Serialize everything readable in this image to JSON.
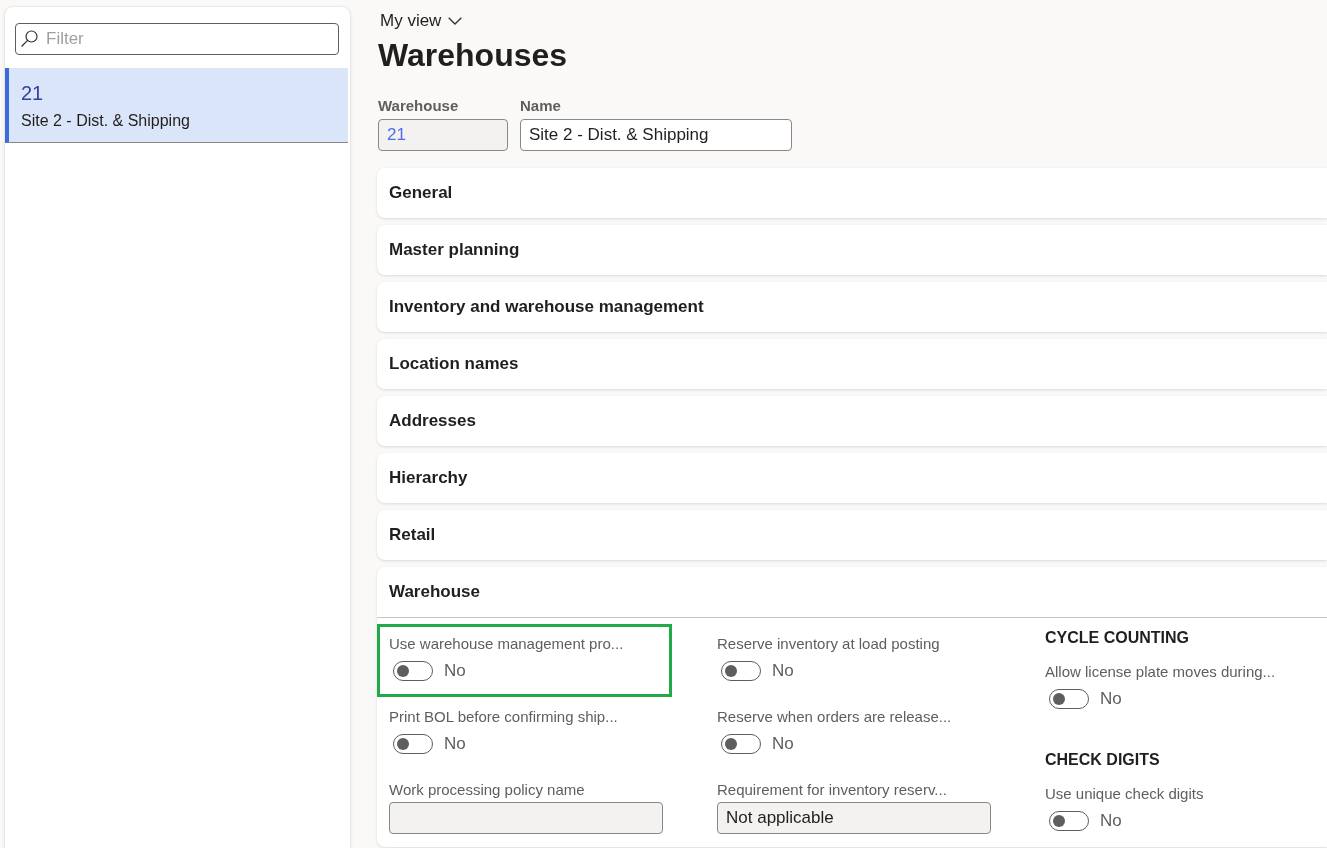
{
  "sidebar": {
    "filter": {
      "placeholder": "Filter"
    },
    "items": [
      {
        "id": "21",
        "name": "Site 2 - Dist. & Shipping",
        "selected": true
      }
    ]
  },
  "header": {
    "view_selector": "My view",
    "title": "Warehouses"
  },
  "fields": [
    {
      "label": "Warehouse",
      "value": "21",
      "disabled": true
    },
    {
      "label": "Name",
      "value": "Site 2 - Dist. & Shipping",
      "disabled": false
    }
  ],
  "fast_tabs": [
    {
      "title": "General",
      "expanded": false
    },
    {
      "title": "Master planning",
      "expanded": false
    },
    {
      "title": "Inventory and warehouse management",
      "expanded": false
    },
    {
      "title": "Location names",
      "expanded": false
    },
    {
      "title": "Addresses",
      "expanded": false
    },
    {
      "title": "Hierarchy",
      "expanded": false
    },
    {
      "title": "Retail",
      "expanded": false
    },
    {
      "title": "Warehouse",
      "expanded": true,
      "columns": [
        {
          "items": [
            {
              "kind": "toggle",
              "label": "Use warehouse management pro...",
              "on": false,
              "state_text": "No",
              "highlighted": true
            },
            {
              "kind": "toggle",
              "label": "Print BOL before confirming ship...",
              "on": false,
              "state_text": "No",
              "highlighted": false
            },
            {
              "kind": "input",
              "label": "Work processing policy name",
              "disabled": true,
              "highlighted": false
            }
          ]
        },
        {
          "items": [
            {
              "kind": "toggle",
              "label": "Reserve inventory at load posting",
              "on": false,
              "state_text": "No",
              "highlighted": false
            },
            {
              "kind": "toggle",
              "label": "Reserve when orders are release...",
              "on": false,
              "state_text": "No",
              "highlighted": false
            },
            {
              "kind": "input",
              "label": "Requirement for inventory reserv...",
              "value": "Not applicable",
              "disabled": true,
              "highlighted": false
            }
          ]
        },
        {
          "items": [
            {
              "kind": "heading",
              "label": "CYCLE COUNTING"
            },
            {
              "kind": "toggle",
              "label": "Allow license plate moves during...",
              "on": false,
              "state_text": "No",
              "highlighted": false
            },
            {
              "kind": "heading",
              "label": "CHECK DIGITS"
            },
            {
              "kind": "toggle",
              "label": "Use unique check digits",
              "on": false,
              "state_text": "No",
              "highlighted": false
            }
          ]
        }
      ]
    }
  ]
}
